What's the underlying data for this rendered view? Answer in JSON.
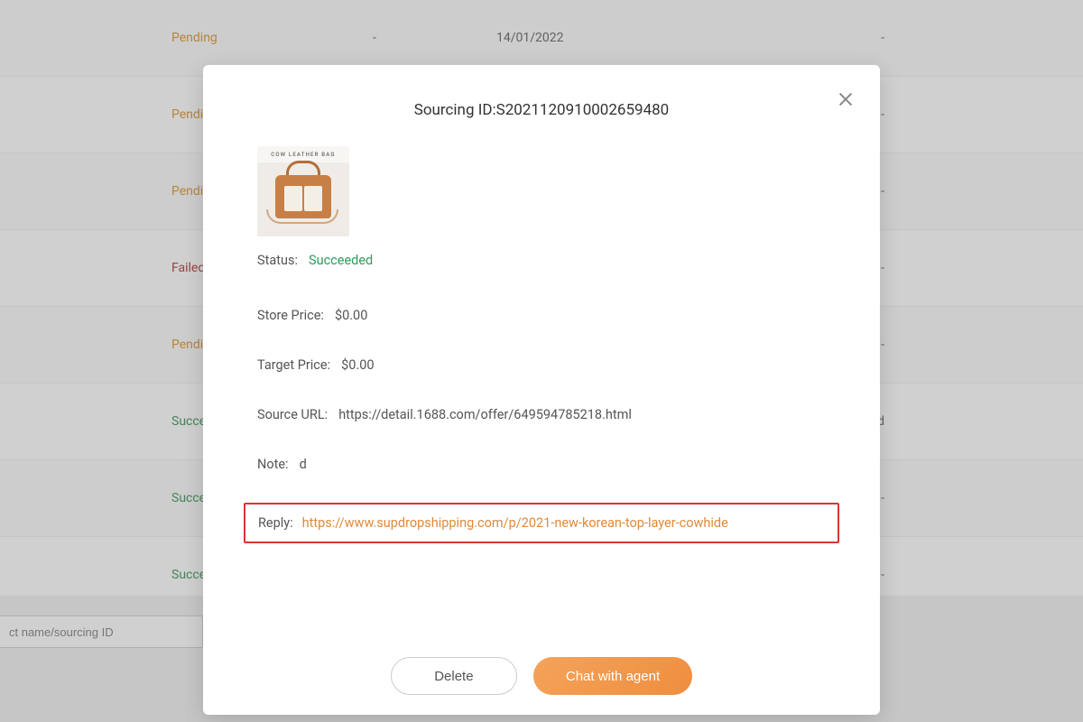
{
  "background": {
    "rows": [
      {
        "status": "Pending",
        "statusClass": "status-pending",
        "dash1": "-",
        "date": "14/01/2022",
        "dash2": "-"
      },
      {
        "status": "Pending",
        "statusClass": "status-pending",
        "dash1": "",
        "date": "",
        "dash2": "-"
      },
      {
        "status": "Pending",
        "statusClass": "status-pending",
        "dash1": "",
        "date": "",
        "dash2": "-"
      },
      {
        "status": "Failed",
        "statusClass": "status-failed",
        "dash1": "",
        "date": "",
        "dash2": "-"
      },
      {
        "status": "Pending",
        "statusClass": "status-pending",
        "dash1": "",
        "date": "",
        "dash2": "-"
      },
      {
        "status": "Succeeded",
        "statusClass": "status-succ",
        "dash1": "",
        "date": "",
        "dash2": "d"
      },
      {
        "status": "Succeeded",
        "statusClass": "status-succ",
        "dash1": "",
        "date": "",
        "dash2": "-"
      },
      {
        "status": "Succeeded",
        "statusClass": "status-succ",
        "dash1": "",
        "date": "",
        "dash2": "-"
      }
    ],
    "search_placeholder": "ct name/sourcing ID"
  },
  "modal": {
    "title": "Sourcing ID:S2021120910002659480",
    "thumb_label": "COW LEATHER BAG",
    "status_label": "Status:",
    "status_value": "Succeeded",
    "store_price_label": "Store Price:",
    "store_price_value": "$0.00",
    "target_price_label": "Target Price:",
    "target_price_value": "$0.00",
    "source_url_label": "Source URL:",
    "source_url_value": "https://detail.1688.com/offer/649594785218.html",
    "note_label": "Note:",
    "note_value": "d",
    "reply_label": "Reply:",
    "reply_value": "https://www.supdropshipping.com/p/2021-new-korean-top-layer-cowhide",
    "delete_label": "Delete",
    "chat_label": "Chat with agent"
  }
}
